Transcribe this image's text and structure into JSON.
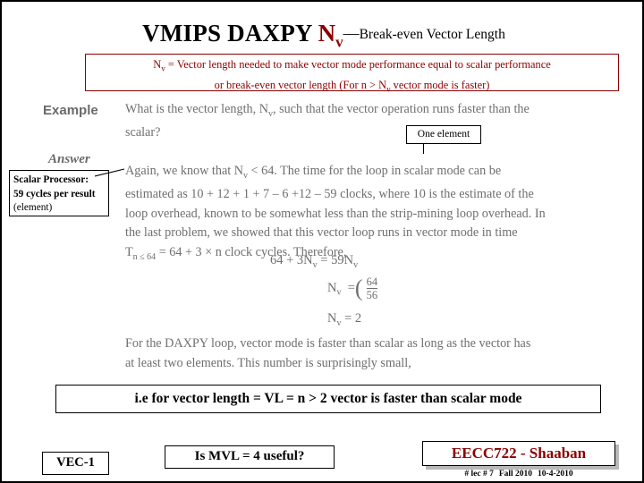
{
  "slide": {
    "title": {
      "main": "VMIPS DAXPY ",
      "symbol": "N",
      "symbol_sub": "v",
      "dash": "—",
      "tail": "Break-even Vector Length"
    },
    "definition_box": {
      "line1_pre": "N",
      "line1_sub": "v",
      "line1_post": " = Vector length needed to make vector mode performance equal to scalar performance",
      "line2_pre": "or break-even vector length (For n > N",
      "line2_sub": "v",
      "line2_post": " vector mode is faster)"
    },
    "labels": {
      "example": "Example",
      "answer": "Answer"
    },
    "question": {
      "line1_a": "What is the vector length, N",
      "line1_sub": "v",
      "line1_b": ", such that the vector operation runs faster than the",
      "line2": "scalar?"
    },
    "answer_text": {
      "line1_a": "Again, we know that N",
      "line1_sub": "v",
      "line1_b": " < 64. The time for the loop in scalar mode can be",
      "line2": "estimated as 10 + 12 + 1 + 7 – 6 +12 – 59 clocks, where 10 is the estimate of the",
      "line3": "loop overhead, known to be somewhat less than the strip-mining loop overhead. In",
      "line4": "the last problem, we showed that this vector loop runs in vector mode in time",
      "line5_a": "T",
      "line5_sub": "n ≤ 64",
      "line5_b": " = 64 + 3 × n clock cycles. Therefore,"
    },
    "equations": {
      "eq1_a": "64 + 3N",
      "eq1_sub1": "v",
      "eq1_b": "  =  59N",
      "eq1_sub2": "v",
      "eq2_a": "N",
      "eq2_sub": "v",
      "eq2_eq": "=",
      "eq2_num": "64",
      "eq2_den": "56",
      "eq3_a": "N",
      "eq3_sub": "v",
      "eq3_b": "  =  2"
    },
    "tail_text": {
      "line1": "For the DAXPY loop, vector mode is faster than scalar as long as the vector has",
      "line2": "at least two elements. This number is surprisingly small,"
    },
    "callouts": {
      "one_element": "One element",
      "scalar_processor_line1": "Scalar Processor:",
      "scalar_processor_line2": "59 cycles per result",
      "scalar_processor_line3": "(element)"
    },
    "conclusion": "i.e for vector length = VL = n  > 2   vector is faster than scalar mode",
    "footer": {
      "vec_tag": "VEC-1",
      "mvl_question": "Is MVL = 4 useful?",
      "course": "EECC722 - Shaaban",
      "meta_lec": "#  lec # 7",
      "meta_term": "Fall 2010",
      "meta_date": "10-4-2010"
    },
    "colors": {
      "accent_red": "#8b0000",
      "scan_gray": "#6f6f6f",
      "border_black": "#000000"
    }
  }
}
